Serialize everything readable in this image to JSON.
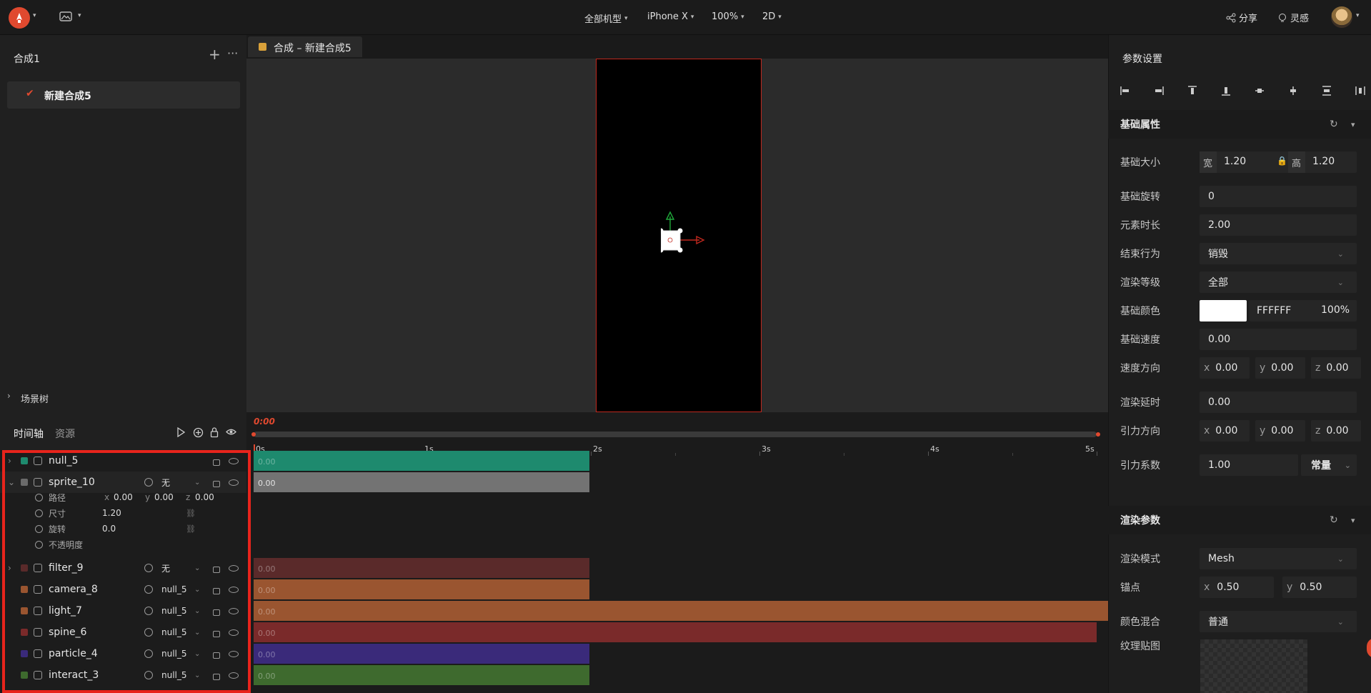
{
  "topbar": {
    "device": "全部机型",
    "model": "iPhone X",
    "zoom": "100%",
    "mode": "2D",
    "share": "分享",
    "inspire": "灵感"
  },
  "left": {
    "title": "合成1",
    "comp_item": "新建合成5",
    "scene_tree": "场景树"
  },
  "canvas": {
    "tab_label": "合成 – 新建合成5"
  },
  "timeline": {
    "tab_timeline": "时间轴",
    "tab_assets": "资源",
    "time": "0:00",
    "ticks": [
      "0s",
      "1s",
      "2s",
      "3s",
      "4s",
      "5s"
    ],
    "layers": [
      {
        "name": "null_5",
        "color": "#1e8a6e",
        "parent": "",
        "bar_value": "0.00"
      },
      {
        "name": "sprite_10",
        "color": "#6b6b6b",
        "parent": "无",
        "bar_value": "0.00"
      },
      {
        "name": "filter_9",
        "color": "#5a2a2a",
        "parent": "无",
        "bar_value": "0.00"
      },
      {
        "name": "camera_8",
        "color": "#9a5530",
        "parent": "null_5",
        "bar_value": "0.00"
      },
      {
        "name": "light_7",
        "color": "#9a5530",
        "parent": "null_5",
        "bar_value": "0.00"
      },
      {
        "name": "spine_6",
        "color": "#7a2a2a",
        "parent": "null_5",
        "bar_value": "0.00"
      },
      {
        "name": "particle_4",
        "color": "#3a2a7a",
        "parent": "null_5",
        "bar_value": "0.00"
      },
      {
        "name": "interact_3",
        "color": "#3e6a2e",
        "parent": "null_5",
        "bar_value": "0.00"
      }
    ],
    "props": {
      "path": "路径",
      "size": "尺寸",
      "rotate": "旋转",
      "opacity": "不透明度",
      "x_label": "x",
      "y_label": "y",
      "z_label": "z",
      "x": "0.00",
      "y": "0.00",
      "z": "0.00",
      "size_val": "1.20",
      "rotate_val": "0.0"
    }
  },
  "right": {
    "title": "参数设置",
    "basic_section": "基础属性",
    "size_label": "基础大小",
    "w_label": "宽",
    "w_val": "1.20",
    "h_label": "高",
    "h_val": "1.20",
    "rotation_label": "基础旋转",
    "rotation_val": "0",
    "duration_label": "元素时长",
    "duration_val": "2.00",
    "end_label": "结束行为",
    "end_val": "销毁",
    "render_level_label": "渲染等级",
    "render_level_val": "全部",
    "color_label": "基础颜色",
    "color_hex": "FFFFFF",
    "color_alpha": "100%",
    "speed_label": "基础速度",
    "speed_val": "0.00",
    "dir_label": "速度方向",
    "dir_x": "0.00",
    "dir_y": "0.00",
    "dir_z": "0.00",
    "delay_label": "渲染延时",
    "delay_val": "0.00",
    "grav_label": "引力方向",
    "grav_x": "0.00",
    "grav_y": "0.00",
    "grav_z": "0.00",
    "grav_coef_label": "引力系数",
    "grav_coef_val": "1.00",
    "grav_coef_mode": "常量",
    "render_section": "渲染参数",
    "render_mode_label": "渲染模式",
    "render_mode_val": "Mesh",
    "anchor_label": "锚点",
    "anchor_x": "0.50",
    "anchor_y": "0.50",
    "blend_label": "颜色混合",
    "blend_val": "普通",
    "texture_label": "纹理贴图",
    "x": "x",
    "y": "y",
    "z": "z"
  }
}
